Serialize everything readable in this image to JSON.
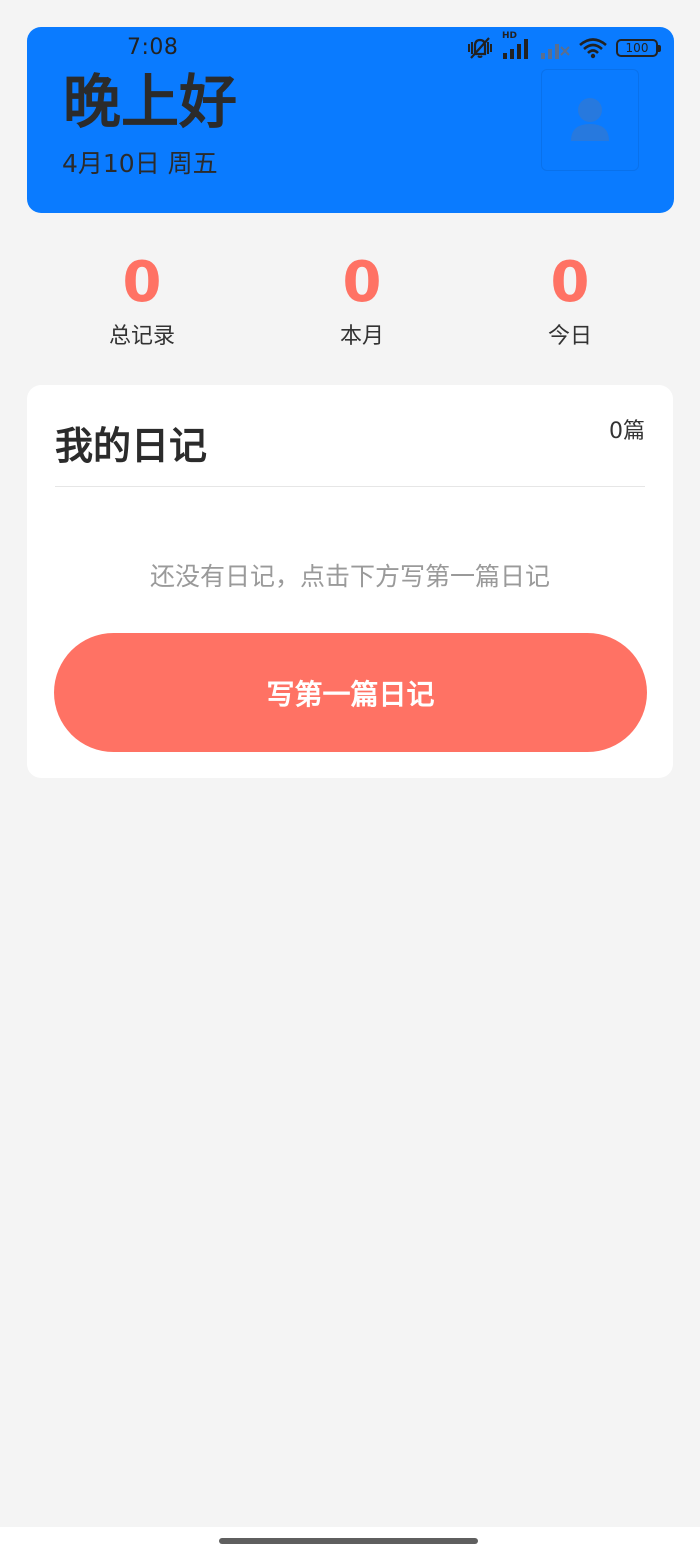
{
  "colors": {
    "header_bg": "#0a7bff",
    "accent": "#ff7264",
    "page_bg": "#f4f4f4"
  },
  "status_bar": {
    "time": "7:08",
    "network_badge": "HD",
    "battery": "100",
    "icons": [
      "mute-vibrate-icon",
      "signal-icon",
      "signal-no-service-icon",
      "wifi-icon",
      "battery-icon"
    ]
  },
  "header": {
    "greeting": "晚上好",
    "date": "4月10日 周五",
    "avatar_icon": "user-avatar-icon"
  },
  "stats": [
    {
      "value": "0",
      "label": "总记录"
    },
    {
      "value": "0",
      "label": "本月"
    },
    {
      "value": "0",
      "label": "今日"
    }
  ],
  "diary": {
    "title": "我的日记",
    "count": "0篇",
    "empty_message": "还没有日记，点击下方写第一篇日记",
    "write_button": "写第一篇日记"
  }
}
